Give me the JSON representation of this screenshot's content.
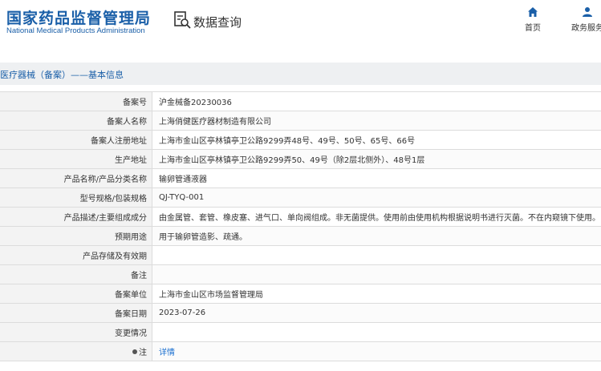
{
  "header": {
    "logo_cn": "国家药品监督管理局",
    "logo_en": "National Medical Products Administration",
    "query_label": "数据查询",
    "nav": [
      {
        "label": "首页",
        "icon": "home-icon"
      },
      {
        "label": "政务服务",
        "icon": "user-icon"
      }
    ]
  },
  "breadcrumb": "医疗器械（备案）——基本信息",
  "rows": [
    {
      "label": "备案号",
      "value": "沪金械备20230036"
    },
    {
      "label": "备案人名称",
      "value": "上海俏健医疗器材制造有限公司"
    },
    {
      "label": "备案人注册地址",
      "value": "上海市金山区亭林镇亭卫公路9299弄48号、49号、50号、65号、66号"
    },
    {
      "label": "生产地址",
      "value": "上海市金山区亭林镇亭卫公路9299弄50、49号（除2层北侧外）、48号1层"
    },
    {
      "label": "产品名称/产品分类名称",
      "value": "输卵管通液器"
    },
    {
      "label": "型号规格/包装规格",
      "value": "QJ-TYQ-001"
    },
    {
      "label": "产品描述/主要组成成分",
      "value": "由金属管、套管、橡皮塞、进气口、单向阀组成。非无菌提供。使用前由使用机构根据说明书进行灭菌。不在内窥镜下使用。"
    },
    {
      "label": "预期用途",
      "value": "用于输卵管造影、疏通。"
    },
    {
      "label": "产品存储及有效期",
      "value": ""
    },
    {
      "label": "备注",
      "value": ""
    },
    {
      "label": "备案单位",
      "value": "上海市金山区市场监督管理局"
    },
    {
      "label": "备案日期",
      "value": "2023-07-26"
    },
    {
      "label": "变更情况",
      "value": ""
    },
    {
      "label": "注",
      "value": "详情"
    }
  ]
}
